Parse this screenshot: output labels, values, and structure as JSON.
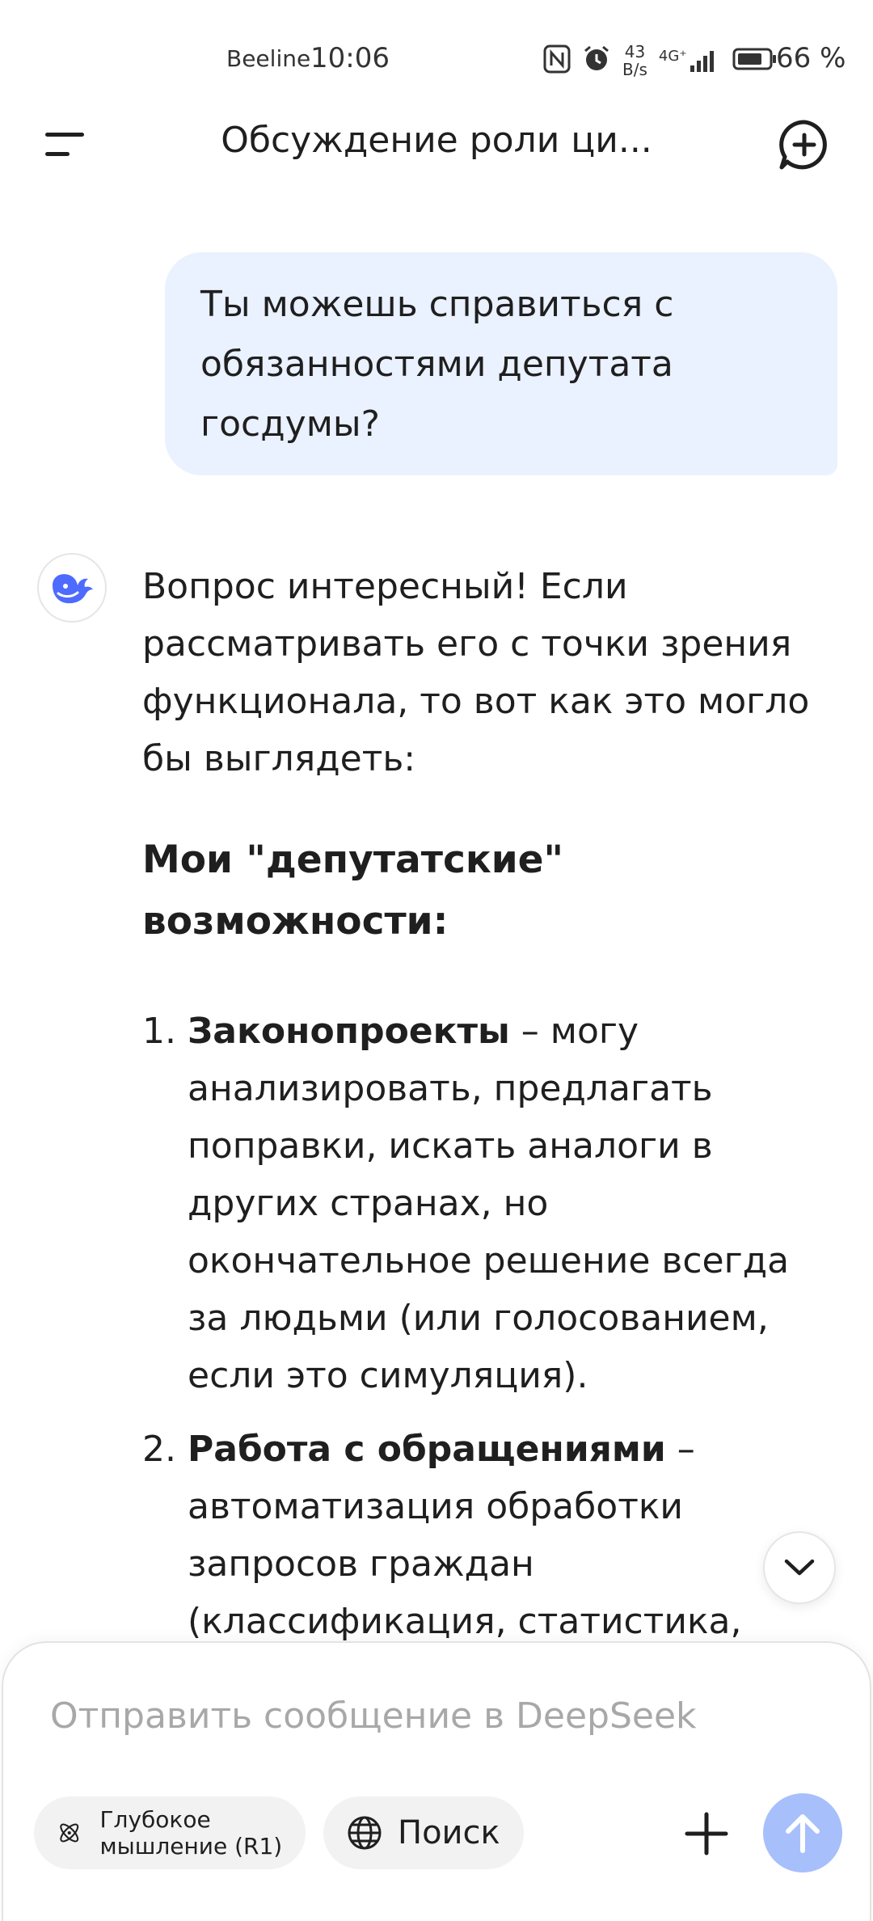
{
  "status_bar": {
    "carrier": "Beeline",
    "time": "10:06",
    "net_speed_value": "43",
    "net_speed_unit": "B/s",
    "network_type": "4G⁺",
    "battery_percent": "66 %",
    "icons": [
      "nfc-icon",
      "alarm-icon",
      "signal-icon",
      "battery-icon"
    ]
  },
  "header": {
    "title": "Обсуждение роли ци...",
    "menu_icon": "menu-icon",
    "new_chat_icon": "new-chat-icon"
  },
  "conversation": {
    "user_message": "Ты можешь справиться с обязанностями депутата госдумы?",
    "assistant": {
      "avatar_icon": "deepseek-whale-icon",
      "intro": "Вопрос интересный! Если рассматривать его с точки зрения функционала, то вот как это могло бы выглядеть:",
      "heading": "Мои \"депутатские\" возможности:",
      "items": [
        {
          "num": "1.",
          "bold": "Законопроекты",
          "text": " – могу анализировать, предлагать поправки, искать аналоги в других странах, но окончательное решение всегда за людьми (или голосованием, если это симуляция)."
        },
        {
          "num": "2.",
          "bold": "Работа с обращениями",
          "text": " – автоматизация обработки запросов граждан (классификация, статистика,"
        }
      ]
    }
  },
  "composer": {
    "placeholder": "Отправить сообщение в DeepSeek",
    "value": "",
    "deep_think_label": "Глубокое мышление (R1)",
    "search_label": "Поиск",
    "icons": {
      "deep_think": "atom-icon",
      "search": "globe-icon",
      "attach": "plus-icon",
      "send": "arrow-up-icon",
      "scroll_down": "chevron-down-icon"
    }
  },
  "colors": {
    "user_bubble": "#eaf1ff",
    "send_button": "#a7bffb",
    "brand_blue": "#4d6bfe",
    "pill_background": "#f2f2f2",
    "placeholder": "#a8a8a8"
  }
}
